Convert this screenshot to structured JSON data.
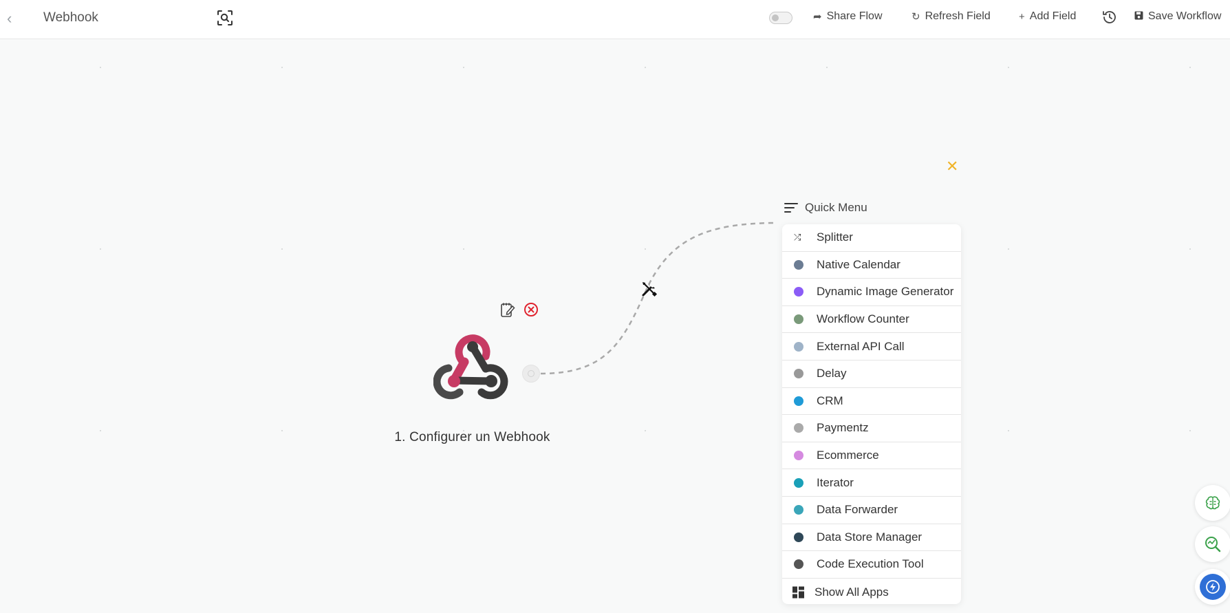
{
  "topbar": {
    "title": "Webhook",
    "share_label": "Share Flow",
    "refresh_label": "Refresh Field",
    "add_field_label": "Add Field",
    "save_label": "Save Workflow",
    "draft_toggle_on": false
  },
  "node": {
    "label": "1. Configurer un Webhook",
    "brand_colors": {
      "top": "#c73b64",
      "bottom": "#3b3b3b",
      "right": "#4a4a4a"
    }
  },
  "quick_menu": {
    "title": "Quick Menu",
    "items": [
      {
        "label": "Splitter",
        "icon": "shuffle-icon",
        "color": "#333333"
      },
      {
        "label": "Native Calendar",
        "icon": "calendar-app-icon",
        "color": "#6b7c93"
      },
      {
        "label": "Dynamic Image Generator",
        "icon": "image-generator-icon",
        "color": "#8b5cf6"
      },
      {
        "label": "Workflow Counter",
        "icon": "counter-icon",
        "color": "#7a9a7a"
      },
      {
        "label": "External API Call",
        "icon": "api-icon",
        "color": "#9fb3c8"
      },
      {
        "label": "Delay",
        "icon": "clock-icon",
        "color": "#999999"
      },
      {
        "label": "CRM",
        "icon": "crm-icon",
        "color": "#1f9bd7"
      },
      {
        "label": "Paymentz",
        "icon": "payment-icon",
        "color": "#aaaaaa"
      },
      {
        "label": "Ecommerce",
        "icon": "cart-icon",
        "color": "#d58ae0"
      },
      {
        "label": "Iterator",
        "icon": "iterator-icon",
        "color": "#1aa0b8"
      },
      {
        "label": "Data Forwarder",
        "icon": "forwarder-icon",
        "color": "#3aa6b9"
      },
      {
        "label": "Data Store Manager",
        "icon": "database-icon",
        "color": "#2f4858"
      },
      {
        "label": "Code Execution Tool",
        "icon": "gear-icon",
        "color": "#555555"
      }
    ],
    "show_all_label": "Show All Apps"
  }
}
